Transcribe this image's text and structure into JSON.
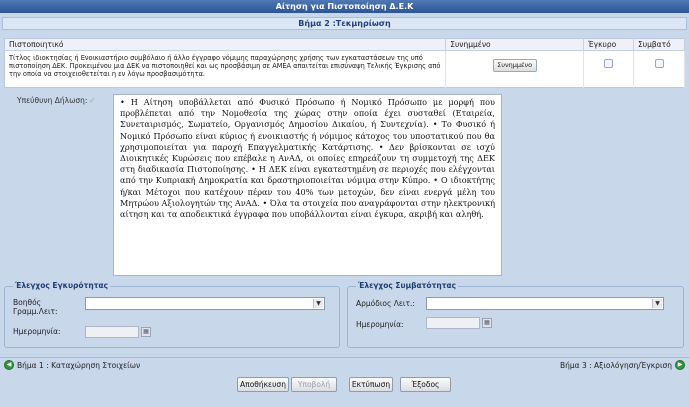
{
  "window": {
    "title": "Αίτηση για Πιστοποίηση Δ.Ε.Κ"
  },
  "step": {
    "title": "Βήμα 2 :Τεκμηρίωση"
  },
  "documents_table": {
    "headers": [
      "Πιστοποιητικό",
      "Συνημμένο",
      "Έγκυρο",
      "Συμβατό"
    ],
    "rows": [
      {
        "document": "Τίτλος ιδιοκτησίας ή Ενοικιαστήριο συμβόλαιο ή άλλο έγγραφο νόμιμης παραχώρησης χρήσης των εγκαταστάσεων της υπό πιστοποίηση ΔΕΚ. Προκειμένου μια ΔΕΚ να πιστοποιηθεί και ως προσβάσιμη σε ΑΜΕΑ απαιτείται επισύναψη Τελικής Έγκρισης από την οποία να στοιχειοθετείται η εν λόγω προσβασιμότητα.",
        "attach_label": "Συνημμένο",
        "valid": false,
        "compatible": false
      }
    ]
  },
  "declaration": {
    "label": "Υπεύθυνη Δήλωση:",
    "checked": true,
    "text": "• Η Αίτηση υποβάλλεται από Φυσικό Πρόσωπο ή Νομικό Πρόσωπο με μορφή που προβλέπεται από την Νομοθεσία της χώρας στην οποία έχει συσταθεί (Εταιρεία, Συνεταιρισμός, Σωματείο, Οργανισμός Δημοσίου Δικαίου, ή Συντεχνία). • Το Φυσικό ή Νομικό Πρόσωπο είναι κύριος ή ενοικιαστής ή νόμιμος κάτοχος του υποστατικού που θα χρησιμοποιείται για παροχή Επαγγελματικής Κατάρτισης. • Δεν βρίσκονται σε ισχύ Διοικητικές Κυρώσεις που επέβαλε η ΑνΑΔ, οι οποίες επηρεάζουν τη συμμετοχή της ΔΕΚ στη διαδικασία Πιστοποίησης. • Η ΔΕΚ είναι εγκατεστημένη σε περιοχές που ελέγχονται από την Κυπριακή Δημοκρατία και δραστηριοποιείται νόμιμα στην Κύπρο. • Ο ιδιοκτήτης ή/και Μέτοχοι που κατέχουν πέραν του 40% των μετοχών, δεν είναι ενεργά μέλη του Μητρώου Αξιολογητών της ΑνΑΔ. • Όλα τα στοιχεία που αναγράφονται στην ηλεκτρονική αίτηση και τα αποδεικτικά έγγραφα που υποβάλλονται είναι έγκυρα, ακριβή και αληθή."
  },
  "validity_check": {
    "legend": "Έλεγχος Εγκυρότητας",
    "assistant_label": "Βοηθός Γραμμ.Λειτ:",
    "assistant_value": "",
    "date_label": "Ημερομηνία:",
    "date_value": ""
  },
  "compat_check": {
    "legend": "Έλεγχος Συμβατότητας",
    "officer_label": "Αρμόδιος Λειτ.:",
    "officer_value": "",
    "date_label": "Ημερομηνία:",
    "date_value": ""
  },
  "navigation": {
    "prev_label": "Βήμα 1 : Καταχώρηση Στοιχείων",
    "next_label": "Βήμα 3 : Αξιολόγηση/Έγκριση"
  },
  "buttons": {
    "save": "Αποθήκευση",
    "submit": "Υποβολή",
    "print": "Εκτύπωση",
    "exit": "Έξοδος"
  },
  "icons": {
    "select_arrow": "chevron-down-icon",
    "calendar": "calendar-icon",
    "prev": "arrow-left-circle-icon",
    "next": "arrow-right-circle-icon"
  }
}
